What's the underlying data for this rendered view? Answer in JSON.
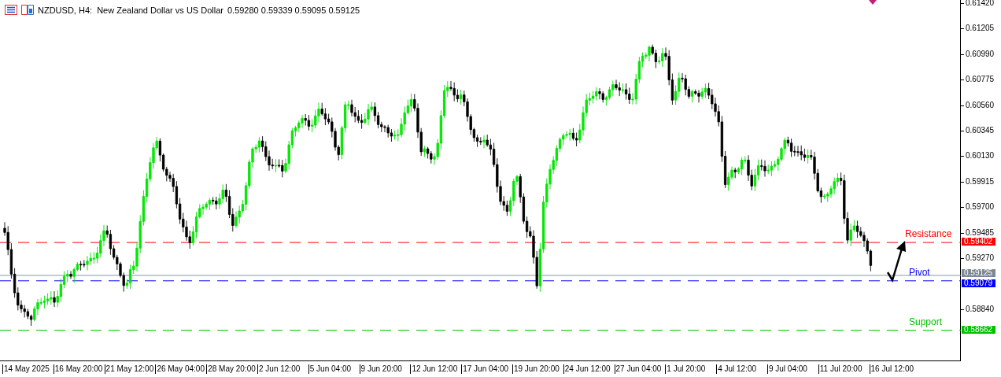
{
  "header": {
    "title": "NZDUSD, H4:  New Zealand Dollar vs US Dollar",
    "quotes": "0.59280 0.59339 0.59095 0.59125"
  },
  "price_axis": [
    "0.61420",
    "0.61205",
    "0.60990",
    "0.60775",
    "0.60560",
    "0.60345",
    "0.60130",
    "0.59915",
    "0.59700",
    "0.59485",
    "0.59270",
    "0.58840"
  ],
  "time_axis": [
    "14 May 2025",
    "16 May 20:00",
    "21 May 12:00",
    "26 May 04:00",
    "28 May 20:00",
    "2 Jun 12:00",
    "5 Jun 04:00",
    "9 Jun 20:00",
    "12 Jun 12:00",
    "17 Jun 04:00",
    "19 Jun 20:00",
    "24 Jun 12:00",
    "27 Jun 04:00",
    "1 Jul 20:00",
    "4 Jul 12:00",
    "9 Jul 04:00",
    "11 Jul 20:00",
    "16 Jul 12:00"
  ],
  "current_price": {
    "price": "0.59125"
  },
  "levels": [
    {
      "kind": "resistance",
      "label": "Resistance",
      "price": "0.59402",
      "color": "#ff0000"
    },
    {
      "kind": "pivot",
      "label": "Pivot",
      "price": "0.59079",
      "color": "#0000ff"
    },
    {
      "kind": "support",
      "label": "Support",
      "price": "0.58662",
      "color": "#00c000"
    }
  ]
}
